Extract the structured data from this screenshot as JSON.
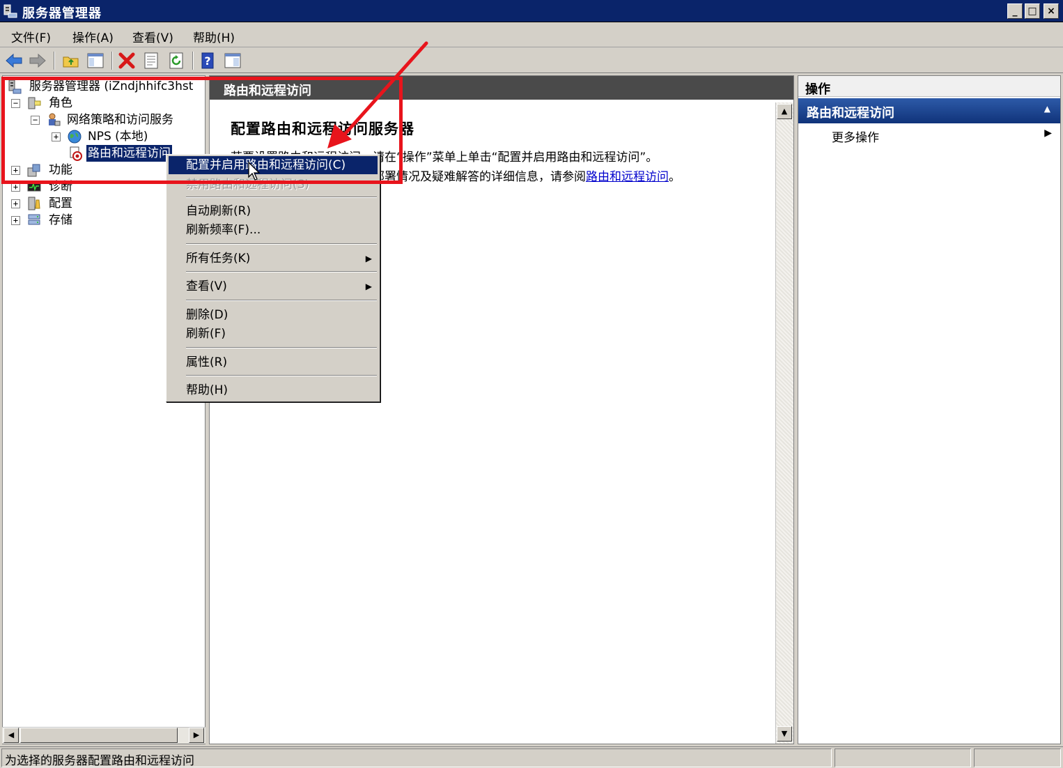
{
  "window": {
    "title": "服务器管理器",
    "controls": {
      "minimize": "_",
      "maximize": "□",
      "close": "×"
    }
  },
  "menubar": [
    "文件(F)",
    "操作(A)",
    "查看(V)",
    "帮助(H)"
  ],
  "toolbar": [
    "back-icon",
    "forward-icon",
    "up-folder-icon",
    "show-hide-tree-icon",
    "delete-icon",
    "properties-icon",
    "refresh-icon",
    "help-icon",
    "show-hide-action-pane-icon"
  ],
  "tree": {
    "root": "服务器管理器 (iZndjhhifc3hst",
    "roles": "角色",
    "nps_service": "网络策略和访问服务",
    "nps_local": "NPS (本地)",
    "rras": "路由和远程访问",
    "features": "功能",
    "diagnostics": "诊断",
    "configuration": "配置",
    "storage": "存储",
    "expanded_glyph": "−",
    "collapsed_glyph": "+"
  },
  "center": {
    "header": "路由和远程访问",
    "heading": "配置路由和远程访问服务器",
    "line1": "若要设置路由和远程访问，请在“操作”菜单上单击“配置并启用路由和远程访问”。",
    "line2_prefix": "有关设置路由和远程访问、部署情况及疑难解答的详细信息，请参阅",
    "line2_link": "路由和远程访问",
    "line2_suffix": "。"
  },
  "actions": {
    "header": "操作",
    "section": "路由和远程访问",
    "more": "更多操作"
  },
  "context_menu": {
    "items": [
      {
        "label": "配置并启用路由和远程访问(C)",
        "state": "highlighted"
      },
      {
        "label": "禁用路由和远程访问(S)",
        "state": "disabled"
      },
      {
        "label": "自动刷新(R)"
      },
      {
        "label": "刷新频率(F)..."
      },
      {
        "label": "所有任务(K)",
        "submenu": true
      },
      {
        "label": "查看(V)",
        "submenu": true
      },
      {
        "label": "删除(D)"
      },
      {
        "label": "刷新(F)"
      },
      {
        "label": "属性(R)"
      },
      {
        "label": "帮助(H)"
      }
    ]
  },
  "status": {
    "text": "为选择的服务器配置路由和远程访问"
  },
  "colors": {
    "annotation_red": "#e8141c",
    "selection_blue": "#0a246a",
    "link_blue": "#0000cc"
  }
}
